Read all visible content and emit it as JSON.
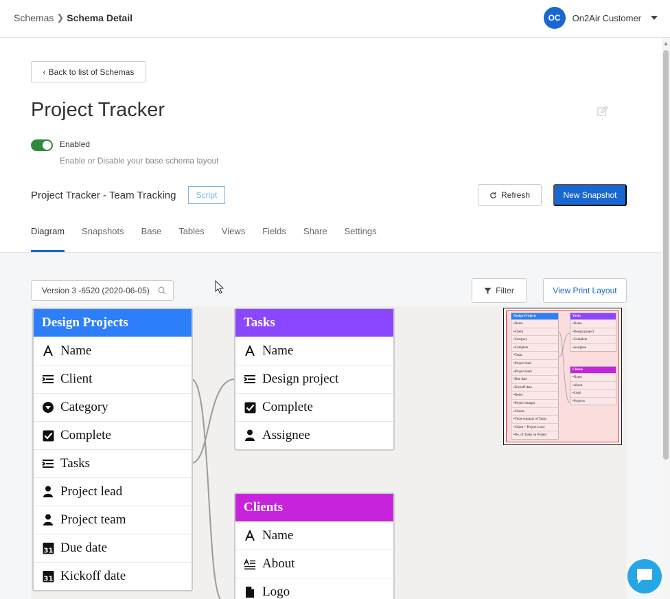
{
  "breadcrumb": {
    "parent": "Schemas",
    "current": "Schema Detail"
  },
  "user": {
    "initials": "OC",
    "name": "On2Air Customer"
  },
  "back_label": "Back to list of Schemas",
  "title": "Project Tracker",
  "toggle": {
    "label": "Enabled",
    "help": "Enable or Disable your base schema layout",
    "on": true
  },
  "base": {
    "name": "Project Tracker - Team Tracking",
    "badge": "Script"
  },
  "buttons": {
    "refresh": "Refresh",
    "new_snapshot": "New Snapshot",
    "filter": "Filter",
    "print": "View Print Layout"
  },
  "tabs": [
    "Diagram",
    "Snapshots",
    "Base",
    "Tables",
    "Views",
    "Fields",
    "Share",
    "Settings"
  ],
  "active_tab": "Diagram",
  "version": "Version 3 -6520 (2020-06-05)",
  "colors": {
    "accent": "#1967d2",
    "design_projects": "#2d7ff9",
    "tasks": "#8b46ff",
    "clients": "#c723dc",
    "toggle_on": "#2e8b3e"
  },
  "diagram": {
    "tables": [
      {
        "name": "Design Projects",
        "fields": [
          {
            "label": "Name",
            "icon": "text-icon"
          },
          {
            "label": "Client",
            "icon": "link-icon"
          },
          {
            "label": "Category",
            "icon": "single-select-icon"
          },
          {
            "label": "Complete",
            "icon": "checkbox-icon"
          },
          {
            "label": "Tasks",
            "icon": "link-icon"
          },
          {
            "label": "Project lead",
            "icon": "user-icon"
          },
          {
            "label": "Project team",
            "icon": "user-icon"
          },
          {
            "label": "Due date",
            "icon": "calendar-icon"
          },
          {
            "label": "Kickoff date",
            "icon": "calendar-icon"
          }
        ]
      },
      {
        "name": "Tasks",
        "fields": [
          {
            "label": "Name",
            "icon": "text-icon"
          },
          {
            "label": "Design project",
            "icon": "link-icon"
          },
          {
            "label": "Complete",
            "icon": "checkbox-icon"
          },
          {
            "label": "Assignee",
            "icon": "user-icon"
          }
        ]
      },
      {
        "name": "Clients",
        "fields": [
          {
            "label": "Name",
            "icon": "text-icon"
          },
          {
            "label": "About",
            "icon": "long-text-icon"
          },
          {
            "label": "Logo",
            "icon": "attachment-icon"
          }
        ]
      }
    ]
  },
  "minimap": {
    "tables": [
      {
        "name": "Design Projects",
        "fields": [
          "Name",
          "Client",
          "Category",
          "Complete",
          "Tasks",
          "Project lead",
          "Project team",
          "Due date",
          "Kickoff date",
          "Notes",
          "Project images",
          "Clients",
          "Time estimate of Tasks",
          "Client + Project Lead",
          "No. of Tasks on Project"
        ]
      },
      {
        "name": "Tasks",
        "fields": [
          "Name",
          "Design project",
          "Complete",
          "Assignee"
        ]
      },
      {
        "name": "Clients",
        "fields": [
          "Name",
          "About",
          "Logo",
          "Projects"
        ]
      }
    ]
  }
}
